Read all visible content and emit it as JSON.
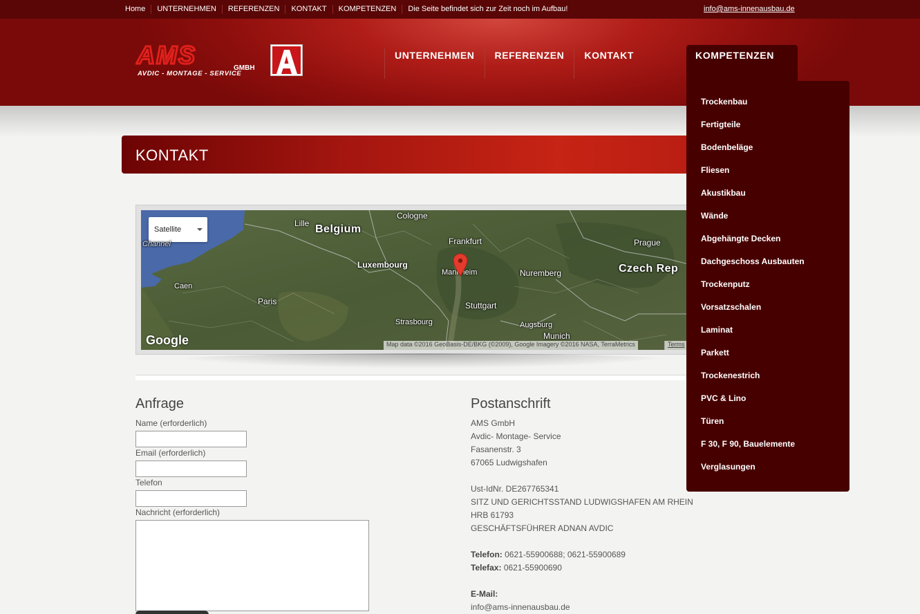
{
  "topbar": {
    "links": [
      "Home",
      "UNTERNEHMEN",
      "REFERENZEN",
      "KONTAKT",
      "KOMPETENZEN"
    ],
    "notice": "Die Seite befindet sich zur Zeit noch im Aufbau!",
    "email": "info@ams-innenausbau.de"
  },
  "logo": {
    "text": "AMS",
    "suffix": "GMBH",
    "tagline": "AVDIC - MONTAGE - SERVICE",
    "badge": "A"
  },
  "mainnav": {
    "items": [
      "UNTERNEHMEN",
      "REFERENZEN",
      "KONTAKT"
    ],
    "active": "KOMPETENZEN"
  },
  "dropdown": {
    "items": [
      "Trockenbau",
      "Fertigteile",
      "Bodenbeläge",
      "Fliesen",
      "Akustikbau",
      "Wände",
      "Abgehängte Decken",
      "Dachgeschoss Ausbauten",
      "Trockenputz",
      "Vorsatzschalen",
      "Laminat",
      "Parkett",
      "Trockenestrich",
      "PVC & Lino",
      "Türen",
      "F 30, F 90, Bauelemente",
      "Verglasungen"
    ]
  },
  "page": {
    "title": "KONTAKT"
  },
  "map": {
    "type_select": "Satellite",
    "labels": {
      "channel": "Channel",
      "lille": "Lille",
      "belgium": "Belgium",
      "cologne": "Cologne",
      "frankfurt": "Frankfurt",
      "prague": "Prague",
      "luxembourg": "Luxembourg",
      "mannheim": "Mannheim",
      "nuremberg": "Nuremberg",
      "czech": "Czech Rep",
      "caen": "Caen",
      "paris": "Paris",
      "stuttgart": "Stuttgart",
      "strasbourg": "Strasbourg",
      "augsburg": "Augsburg",
      "munich": "Munich"
    },
    "google": "Google",
    "attribution": "Map data ©2016 GeoBasis-DE/BKG (©2009), Google Imagery ©2016 NASA, TerraMetrics",
    "terms": "Terms"
  },
  "form": {
    "title": "Anfrage",
    "name_label": "Name (erforderlich)",
    "email_label": "Email (erforderlich)",
    "phone_label": "Telefon",
    "message_label": "Nachricht (erforderlich)"
  },
  "address": {
    "title": "Postanschrift",
    "company": "AMS GmbH",
    "subtitle": "Avdic- Montage- Service",
    "street": "Fasanenstr. 3",
    "city": "67065 Ludwigshafen",
    "vat": "Ust-IdNr. DE267765341",
    "seat": "SITZ UND GERICHTSSTAND LUDWIGSHAFEN AM RHEIN",
    "hrb": "HRB 61793",
    "ceo": "GESCHÄFTSFÜHRER ADNAN AVDIC",
    "phone_label": "Telefon:",
    "phone": "0621-55900688; 0621-55900689",
    "fax_label": "Telefax:",
    "fax": "0621-55900690",
    "email_label": "E-Mail:",
    "email": "info@ams-innenausbau.de"
  },
  "colors": {
    "topbar": "#5a0606",
    "header_red": "#b01d18",
    "dropdown": "#470000",
    "logo_red": "#e0201c"
  }
}
